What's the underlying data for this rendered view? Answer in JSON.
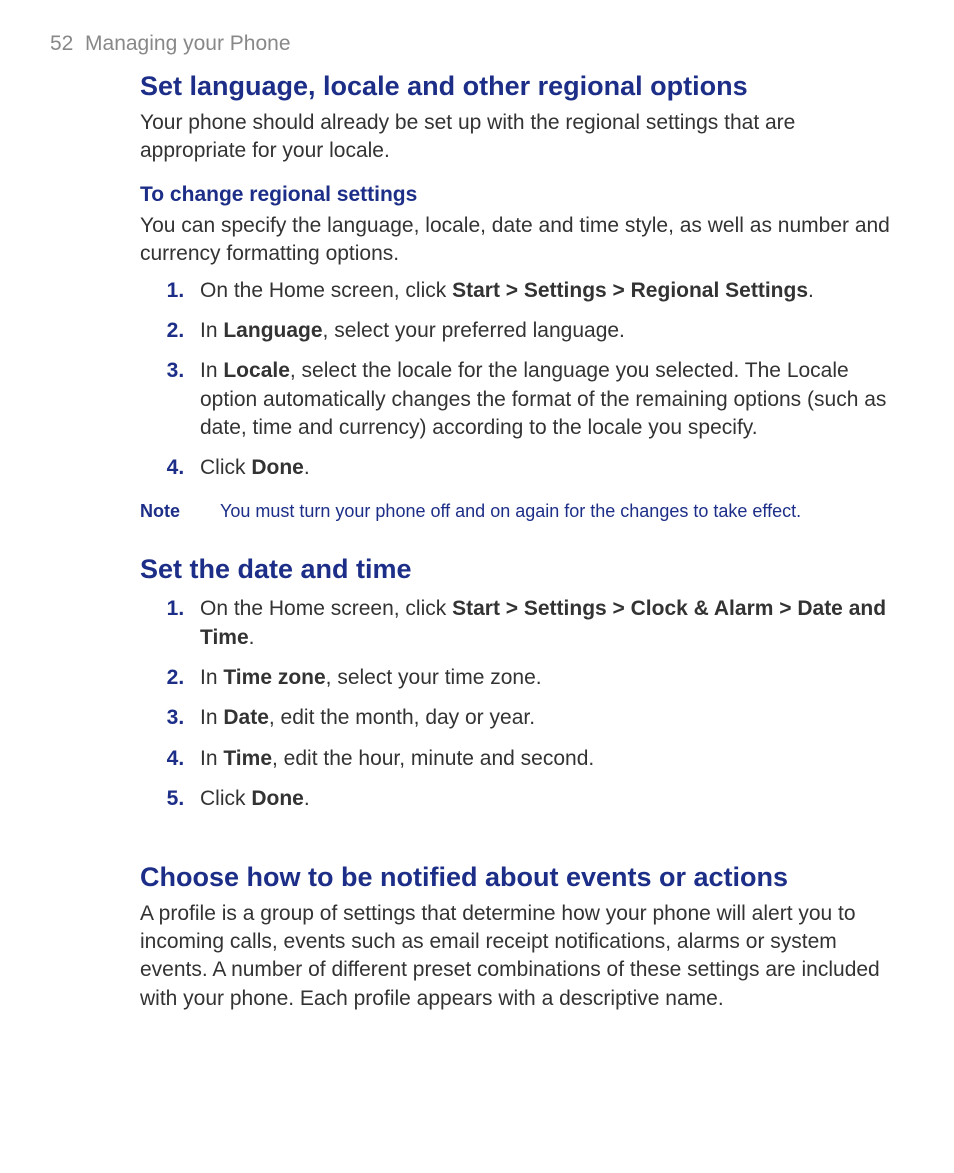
{
  "header": {
    "page_number": "52",
    "chapter_title": "Managing your Phone"
  },
  "section1": {
    "heading": "Set language, locale and other regional options",
    "intro": "Your phone should already be set up with the regional settings that are appropriate for your locale.",
    "sub_heading": "To change regional settings",
    "sub_intro": "You can specify the language, locale, date and time style, as well as number and currency formatting options.",
    "steps": {
      "s1_pre": "On the Home screen, click ",
      "s1_bold": "Start > Settings > Regional Settings",
      "s1_post": ".",
      "s2_pre": "In ",
      "s2_bold": "Language",
      "s2_post": ", select your preferred language.",
      "s3_pre": "In ",
      "s3_bold": "Locale",
      "s3_post": ", select the locale for the language you selected. The Locale option automatically changes the format of the remaining options (such as date, time and currency) according to the locale you specify.",
      "s4_pre": "Click ",
      "s4_bold": "Done",
      "s4_post": "."
    },
    "note_label": "Note",
    "note_text": "You must turn your phone off and on again for the changes to take effect."
  },
  "section2": {
    "heading": "Set the date and time",
    "steps": {
      "s1_pre": "On the Home screen, click ",
      "s1_bold": "Start > Settings > Clock & Alarm > Date and Time",
      "s1_post": ".",
      "s2_pre": "In ",
      "s2_bold": "Time zone",
      "s2_post": ", select your time zone.",
      "s3_pre": "In ",
      "s3_bold": "Date",
      "s3_post": ", edit the month, day or year.",
      "s4_pre": "In ",
      "s4_bold": "Time",
      "s4_post": ", edit the hour, minute and second.",
      "s5_pre": "Click ",
      "s5_bold": "Done",
      "s5_post": "."
    }
  },
  "section3": {
    "heading": "Choose how to be notified about events or actions",
    "intro": "A profile is a group of settings that determine how your phone will alert you to incoming calls, events such as email receipt notifications, alarms or system events. A number of different preset combinations of these settings are included with your phone. Each profile appears with a descriptive name."
  }
}
